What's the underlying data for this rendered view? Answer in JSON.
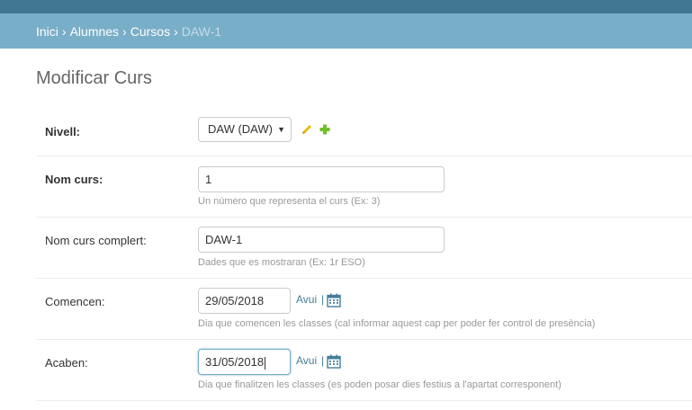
{
  "breadcrumbs": {
    "home": "Inici",
    "app": "Alumnes",
    "model": "Cursos",
    "current": "DAW-1",
    "separator": "›"
  },
  "page_title": "Modificar Curs",
  "fields": {
    "nivell": {
      "label": "Nivell:",
      "selected": "DAW (DAW)",
      "change_icon": "pencil-icon",
      "add_icon": "plus-icon"
    },
    "nom_curs": {
      "label": "Nom curs:",
      "value": "1",
      "help": "Un número que representa el curs (Ex: 3)"
    },
    "nom_curs_complert": {
      "label": "Nom curs complert:",
      "value": "DAW-1",
      "help": "Dades que es mostraran (Ex: 1r ESO)"
    },
    "comencen": {
      "label": "Comencen:",
      "value": "29/05/2018",
      "today": "Avui",
      "pipe": "|",
      "help": "Dia que comencen les classes (cal informar aquest cap per poder fer control de presència)"
    },
    "acaben": {
      "label": "Acaben:",
      "value": "31/05/2018",
      "today": "Avui",
      "pipe": "|",
      "help": "Dia que finalitzen les classes (es poden posar dies festius a l'apartat corresponent)"
    }
  },
  "colors": {
    "header": "#417690",
    "breadcrumb_bar": "#79aec8",
    "link": "#447e9b",
    "pencil": "#efb80b",
    "plus": "#70bf2b"
  }
}
